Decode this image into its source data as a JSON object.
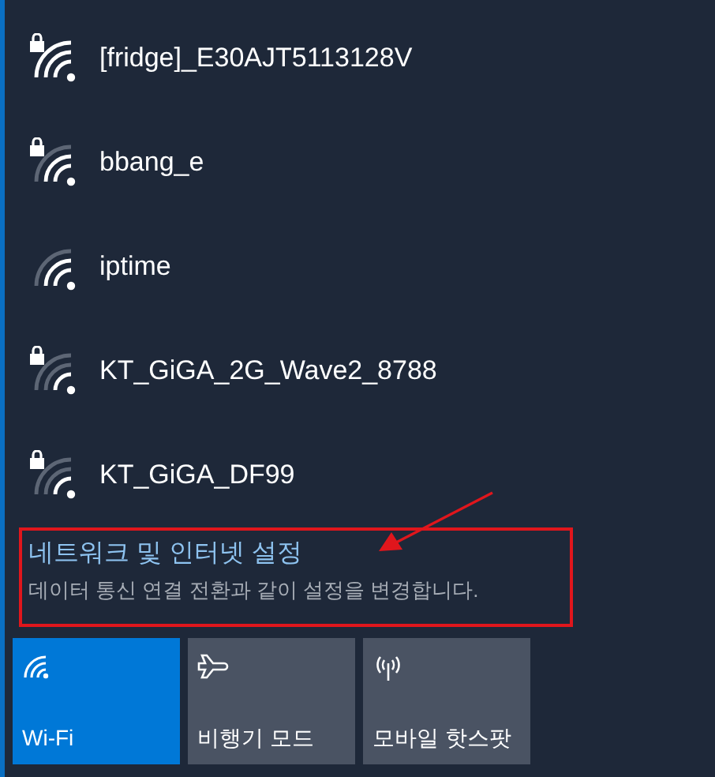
{
  "networks": [
    {
      "name": "[fridge]_E30AJT5113128V",
      "secured": true,
      "kind": "strong"
    },
    {
      "name": "bbang_e",
      "secured": true,
      "kind": "medium"
    },
    {
      "name": "iptime",
      "secured": false,
      "kind": "medium"
    },
    {
      "name": "KT_GiGA_2G_Wave2_8788",
      "secured": true,
      "kind": "weak"
    },
    {
      "name": "KT_GiGA_DF99",
      "secured": true,
      "kind": "weak"
    }
  ],
  "settings_link": {
    "title": "네트워크 및 인터넷 설정",
    "description": "데이터 통신 연결 전환과 같이 설정을 변경합니다."
  },
  "quick_actions": [
    {
      "kind": "wifi",
      "label": "Wi-Fi",
      "on": true
    },
    {
      "kind": "airplane",
      "label": "비행기 모드",
      "on": false
    },
    {
      "kind": "hotspot",
      "label": "모바일 핫스팟",
      "on": false
    }
  ]
}
